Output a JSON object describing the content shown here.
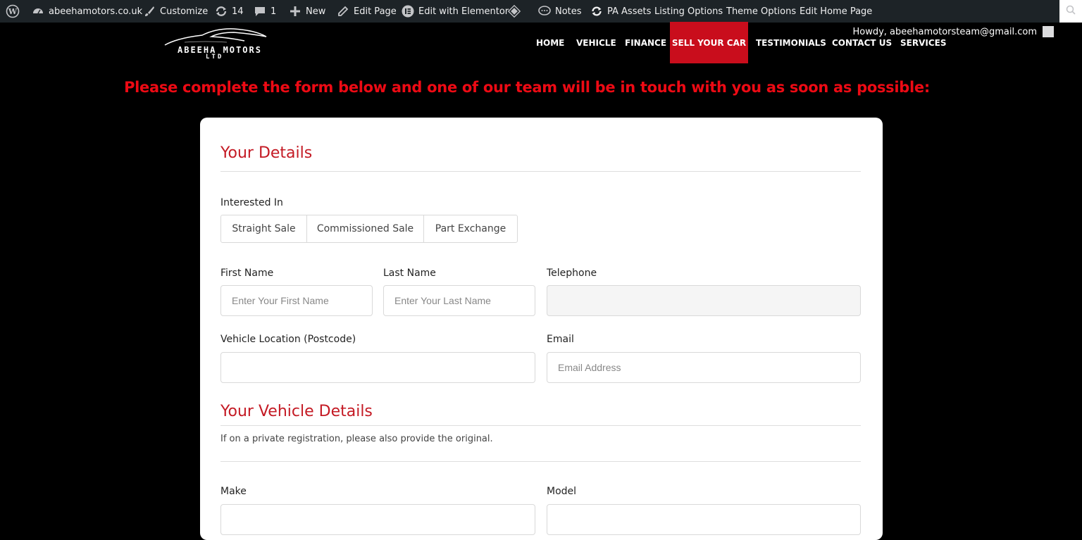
{
  "adminbar": {
    "site": "abeehamotors.co.uk",
    "customize": "Customize",
    "updates": "14",
    "comments": "1",
    "new": "New",
    "edit_page": "Edit Page",
    "edit_elementor": "Edit with Elementor",
    "notes": "Notes",
    "pa_assets": "PA Assets",
    "listing_options": "Listing Options",
    "theme_options": "Theme Options",
    "edit_home": "Edit Home Page",
    "howdy": "Howdy, abeehamotorsteam@gmail.com"
  },
  "logo": {
    "name": "ABEEHA MOTORS",
    "sub": "LTD"
  },
  "nav": {
    "home": "HOME",
    "vehicle": "VEHICLE",
    "finance": "FINANCE",
    "sell": "SELL YOUR CAR",
    "testimonials": "TESTIMONIALS",
    "contact": "CONTACT US",
    "services": "SERVICES"
  },
  "headline": "Please complete the form below and one of our team will be in touch with you as soon as possible:",
  "form": {
    "details_title": "Your Details",
    "interested_label": "Interested In",
    "options": [
      "Straight Sale",
      "Commissioned Sale",
      "Part Exchange"
    ],
    "first_name_label": "First Name",
    "first_name_placeholder": "Enter Your First Name",
    "last_name_label": "Last Name",
    "last_name_placeholder": "Enter Your Last Name",
    "telephone_label": "Telephone",
    "location_label": "Vehicle Location (Postcode)",
    "email_label": "Email",
    "email_placeholder": "Email Address",
    "vehicle_title": "Your Vehicle Details",
    "vehicle_note": "If on a private registration, please also provide the original.",
    "make_label": "Make",
    "model_label": "Model"
  },
  "colors": {
    "accent": "#c90d1c",
    "headline": "#ed0a14",
    "section_title": "#c41a24",
    "adminbar": "#1d2327"
  }
}
